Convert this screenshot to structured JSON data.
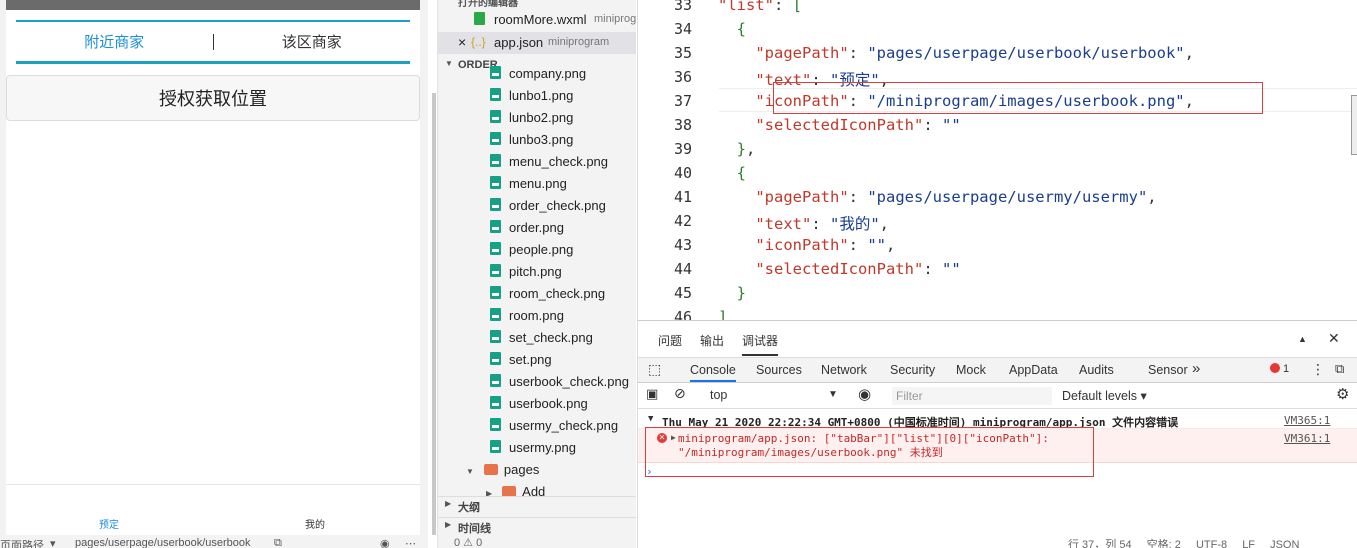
{
  "simulator": {
    "tab_nearby": "附近商家",
    "tab_separator": "|",
    "tab_area": "该区商家",
    "auth_button": "授权获取位置",
    "tabbar_book": "预定",
    "tabbar_my": "我的",
    "status_path_label": "页面路径",
    "status_path": "pages/userpage/userbook/userbook"
  },
  "explorer": {
    "open_editors_header": "打开的编辑器",
    "open_files": [
      {
        "name": "roomMore.wxml",
        "tag": "miniprogram"
      },
      {
        "name": "app.json",
        "tag": "miniprogram"
      }
    ],
    "order_header": "ORDER",
    "files": [
      "company.png",
      "lunbo1.png",
      "lunbo2.png",
      "lunbo3.png",
      "menu_check.png",
      "menu.png",
      "order_check.png",
      "order.png",
      "people.png",
      "pitch.png",
      "room_check.png",
      "room.png",
      "set_check.png",
      "set.png",
      "userbook_check.png",
      "userbook.png",
      "usermy_check.png",
      "usermy.png"
    ],
    "folder_pages": "pages",
    "folder_add": "Add",
    "outline_header": "大纲",
    "timeline_header": "时间线",
    "status": "0 ⚠ 0"
  },
  "editor": {
    "lines": [
      33,
      34,
      35,
      36,
      37,
      38,
      39,
      40,
      41,
      42,
      43,
      44,
      45,
      46
    ],
    "code": {
      "l33_key": "\"list\"",
      "l35_key": "\"pagePath\"",
      "l35_val": "\"pages/userpage/userbook/userbook\"",
      "l36_key": "\"text\"",
      "l36_val": "\"预定\"",
      "l37_key": "\"iconPath\"",
      "l37_val": "\"/miniprogram/images/userbook.png\"",
      "l38_key": "\"selectedIconPath\"",
      "l38_val": "\"\"",
      "l41_key": "\"pagePath\"",
      "l41_val": "\"pages/userpage/usermy/usermy\"",
      "l42_key": "\"text\"",
      "l42_val": "\"我的\"",
      "l43_key": "\"iconPath\"",
      "l43_val": "\"\"",
      "l44_key": "\"selectedIconPath\"",
      "l44_val": "\"\""
    }
  },
  "debugger": {
    "top_tabs": [
      "问题",
      "输出",
      "调试器"
    ],
    "dev_tabs": [
      "Console",
      "Sources",
      "Network",
      "Security",
      "Mock",
      "AppData",
      "Audits",
      "Sensor"
    ],
    "more": "»",
    "error_count": "1",
    "context": "top",
    "filter_placeholder": "Filter",
    "levels": "Default levels ▾",
    "group_message": "Thu May 21 2020 22:22:34 GMT+0800 (中国标准时间)  miniprogram/app.json 文件内容错误",
    "group_link": "VM365:1",
    "error_message": "miniprogram/app.json: [\"tabBar\"][\"list\"][0][\"iconPath\"]:\n\"/miniprogram/images/userbook.png\" 未找到",
    "error_link": "VM361:1",
    "prompt": "›"
  },
  "statusbar": {
    "position": "行 37，列 54",
    "indent": "空格: 2",
    "encoding": "UTF-8",
    "eol": "LF",
    "lang": "JSON"
  },
  "colors": {
    "accent": "#1aa1c5",
    "tab_active": "#1a8fd8",
    "json_key": "#c0392b",
    "json_string": "#1a3d8f",
    "highlight_border": "#d93f3f",
    "error_text": "#c62828"
  }
}
